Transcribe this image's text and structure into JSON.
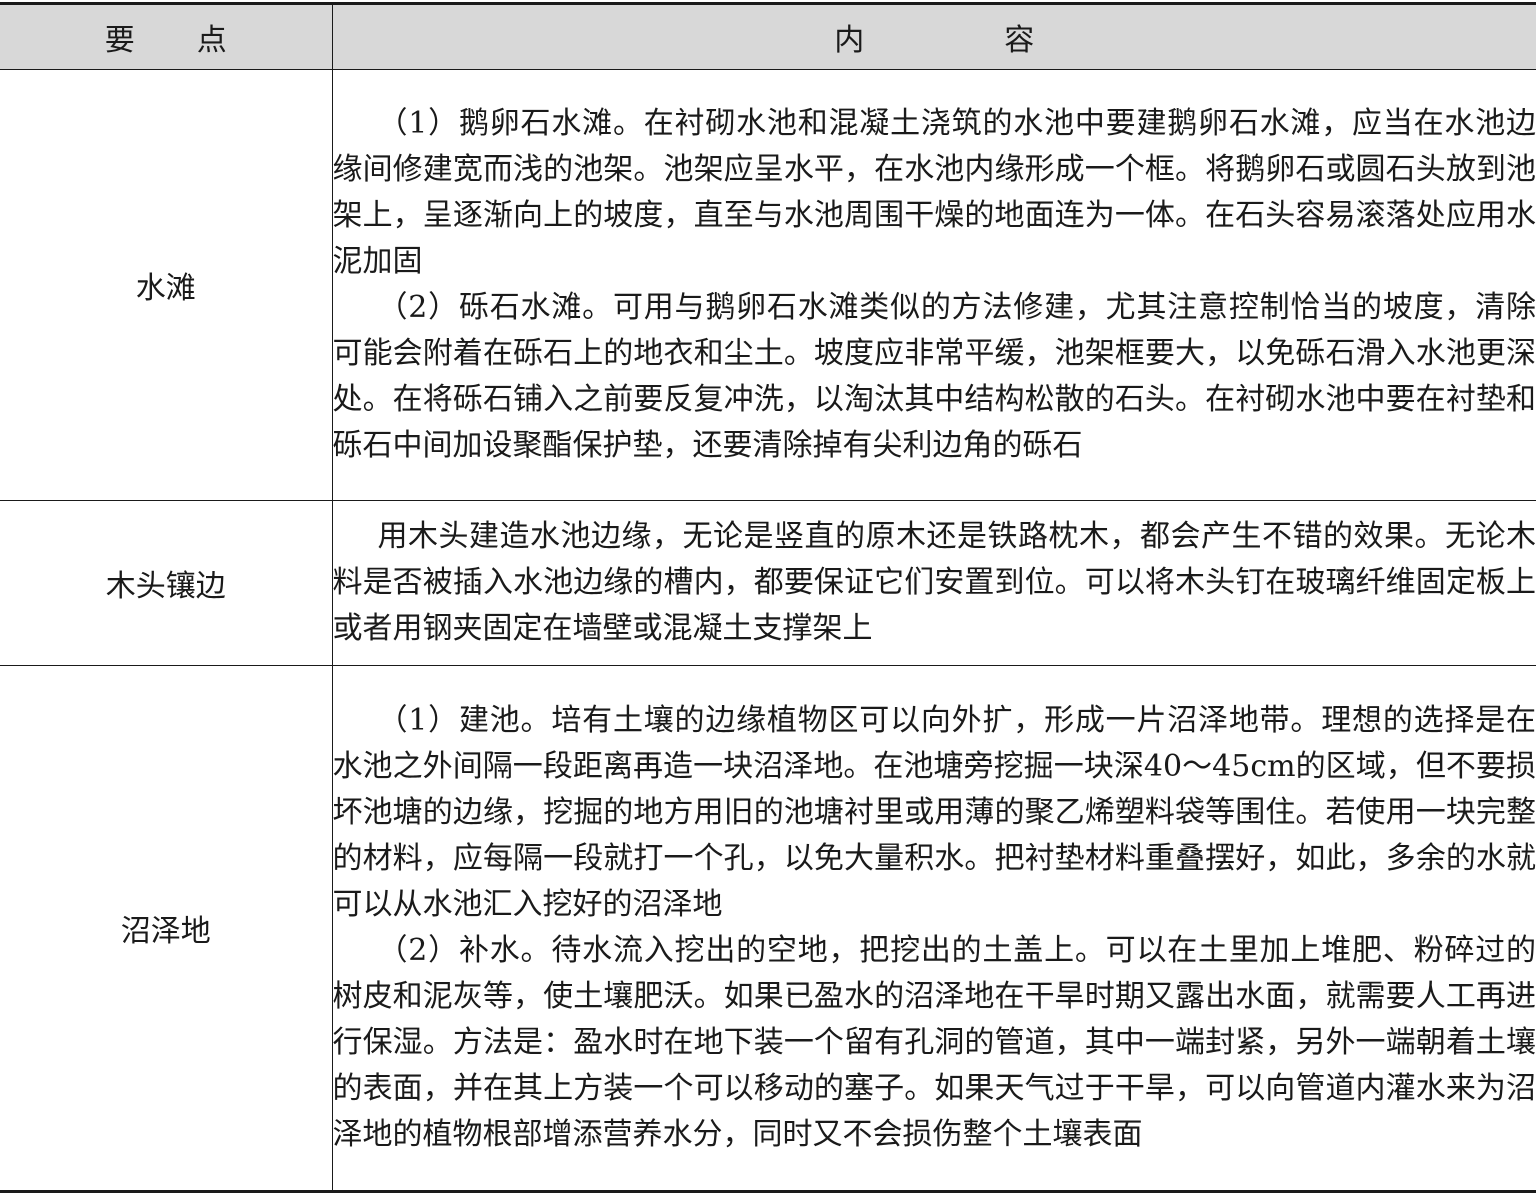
{
  "table": {
    "header": {
      "key": "要点",
      "content": "内容"
    },
    "rows": [
      {
        "key": "水滩",
        "paragraphs": [
          "（1）鹅卵石水滩。在衬砌水池和混凝土浇筑的水池中要建鹅卵石水滩，应当在水池边缘间修建宽而浅的池架。池架应呈水平，在水池内缘形成一个框。将鹅卵石或圆石头放到池架上，呈逐渐向上的坡度，直至与水池周围干燥的地面连为一体。在石头容易滚落处应用水泥加固",
          "（2）砾石水滩。可用与鹅卵石水滩类似的方法修建，尤其注意控制恰当的坡度，清除可能会附着在砾石上的地衣和尘土。坡度应非常平缓，池架框要大，以免砾石滑入水池更深处。在将砾石铺入之前要反复冲洗，以淘汰其中结构松散的石头。在衬砌水池中要在衬垫和砾石中间加设聚酯保护垫，还要清除掉有尖利边角的砾石"
        ]
      },
      {
        "key": "木头镶边",
        "paragraphs": [
          "用木头建造水池边缘，无论是竖直的原木还是铁路枕木，都会产生不错的效果。无论木料是否被插入水池边缘的槽内，都要保证它们安置到位。可以将木头钉在玻璃纤维固定板上或者用钢夹固定在墙壁或混凝土支撑架上"
        ]
      },
      {
        "key": "沼泽地",
        "paragraphs": [
          "（1）建池。培有土壤的边缘植物区可以向外扩，形成一片沼泽地带。理想的选择是在水池之外间隔一段距离再造一块沼泽地。在池塘旁挖掘一块深40～45cm的区域，但不要损坏池塘的边缘，挖掘的地方用旧的池塘衬里或用薄的聚乙烯塑料袋等围住。若使用一块完整的材料，应每隔一段就打一个孔，以免大量积水。把衬垫材料重叠摆好，如此，多余的水就可以从水池汇入挖好的沼泽地",
          "（2）补水。待水流入挖出的空地，把挖出的土盖上。可以在土里加上堆肥、粉碎过的树皮和泥灰等，使土壤肥沃。如果已盈水的沼泽地在干旱时期又露出水面，就需要人工再进行保湿。方法是：盈水时在地下装一个留有孔洞的管道，其中一端封紧，另外一端朝着土壤的表面，并在其上方装一个可以移动的塞子。如果天气过于干旱，可以向管道内灌水来为沼泽地的植物根部增添营养水分，同时又不会损伤整个土壤表面"
        ]
      }
    ]
  }
}
